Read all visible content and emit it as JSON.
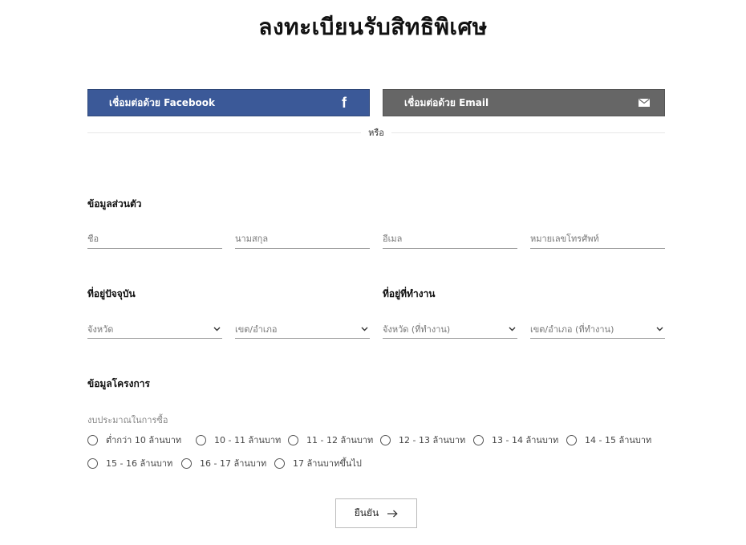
{
  "page": {
    "title": "ลงทะเบียนรับสิทธิพิเศษ"
  },
  "social": {
    "facebook_label": "เชื่อมต่อด้วย Facebook",
    "facebook_icon": "facebook-icon",
    "email_label": "เชื่อมต่อด้วย Email",
    "email_icon": "mail-icon",
    "or_label": "หรือ",
    "facebook_color": "#3b5998",
    "email_color": "#666666"
  },
  "personal": {
    "heading": "ข้อมูลส่วนตัว",
    "first_name_placeholder": "ชื่อ",
    "last_name_placeholder": "นามสกุล",
    "email_placeholder": "อีเมล",
    "phone_placeholder": "หมายเลขโทรศัพท์"
  },
  "address": {
    "current_heading": "ที่อยู่ปัจจุบัน",
    "work_heading": "ที่อยู่ที่ทำงาน",
    "province": "จังหวัด",
    "district": "เขต/อำเภอ",
    "work_province": "จังหวัด (ที่ทำงาน)",
    "work_district": "เขต/อำเภอ (ที่ทำงาน)"
  },
  "project": {
    "heading": "ข้อมูลโครงการ",
    "budget_label": "งบประมาณในการซื้อ",
    "options": [
      "ต่ำกว่า 10 ล้านบาท",
      "10 - 11 ล้านบาท",
      "11 - 12 ล้านบาท",
      "12 - 13 ล้านบาท",
      "13 - 14 ล้านบาท",
      "14 - 15 ล้านบาท",
      "15 - 16 ล้านบาท",
      "16 - 17 ล้านบาท",
      "17 ล้านบาทขึ้นไป"
    ]
  },
  "submit": {
    "label": "ยืนยัน",
    "icon": "arrow-right-icon"
  }
}
